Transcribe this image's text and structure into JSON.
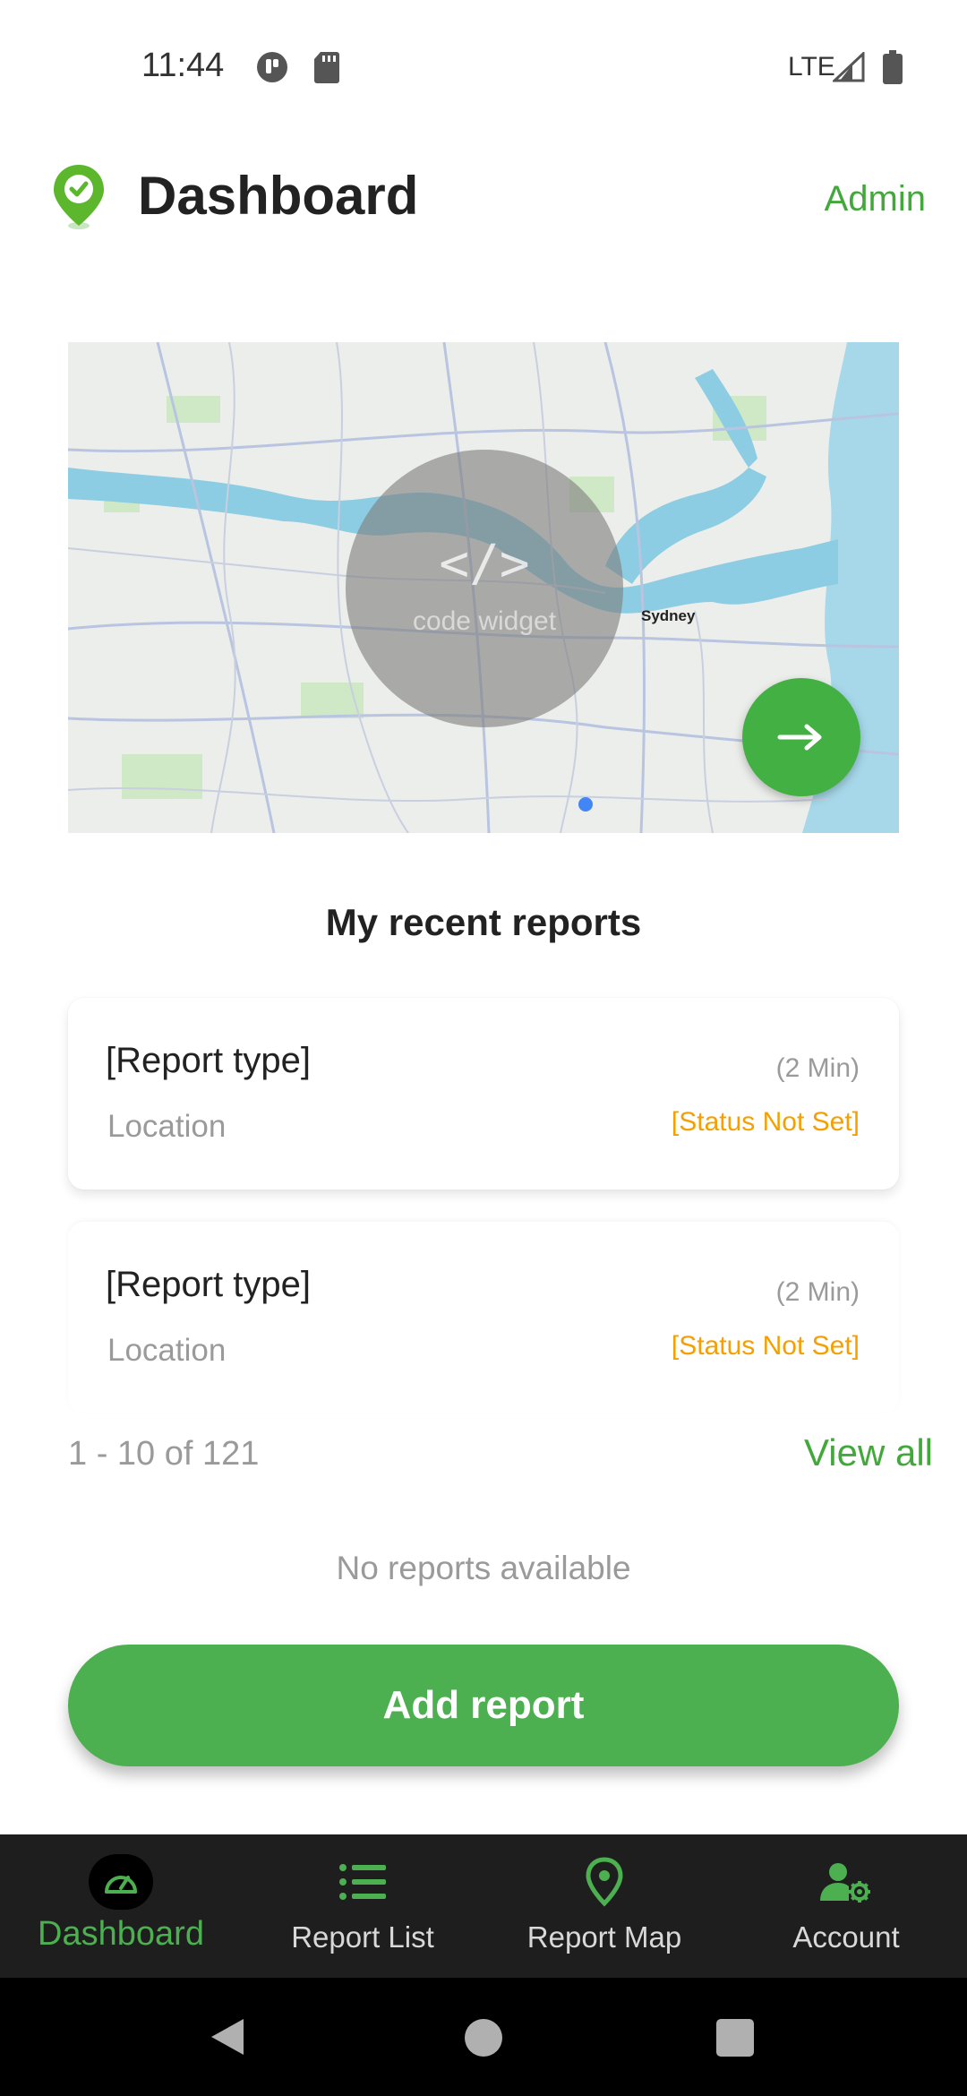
{
  "status_bar": {
    "time": "11:44",
    "network": "LTE",
    "icons": [
      "app-notification-icon",
      "sd-card-icon",
      "signal-icon",
      "battery-icon"
    ]
  },
  "header": {
    "title": "Dashboard",
    "admin_label": "Admin",
    "logo_icon": "location-check-icon"
  },
  "map": {
    "widget_symbol": "</>",
    "widget_label": "code widget",
    "city_label": "Sydney",
    "fab_icon": "arrow-right-icon"
  },
  "recent": {
    "title": "My recent reports",
    "reports": [
      {
        "type": "[Report type]",
        "location": "Location",
        "time": "(2 Min)",
        "status": "[Status Not Set]"
      },
      {
        "type": "[Report type]",
        "location": "Location",
        "time": "(2 Min)",
        "status": "[Status Not Set]"
      }
    ],
    "pagination": "1 - 10 of 121",
    "view_all_label": "View all",
    "empty_text": "No reports available"
  },
  "add_button_label": "Add report",
  "bottom_nav": {
    "items": [
      {
        "label": "Dashboard",
        "icon": "dashboard-gauge-icon",
        "active": true
      },
      {
        "label": "Report List",
        "icon": "list-icon",
        "active": false
      },
      {
        "label": "Report Map",
        "icon": "map-pin-icon",
        "active": false
      },
      {
        "label": "Account",
        "icon": "account-settings-icon",
        "active": false
      }
    ]
  },
  "colors": {
    "accent": "#4caf50",
    "status_warning": "#f5a000",
    "muted_text": "#9a9a9a",
    "nav_background": "#1e1e1e"
  }
}
